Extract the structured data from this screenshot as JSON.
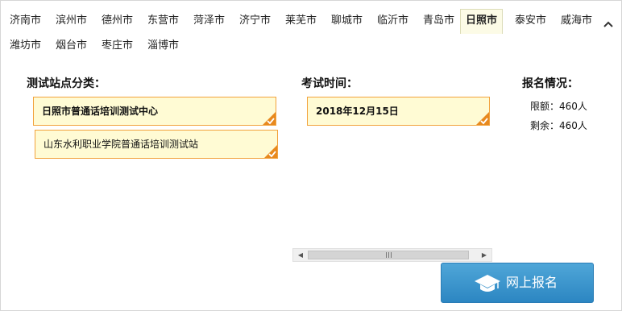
{
  "cities": [
    "济南市",
    "滨州市",
    "德州市",
    "东营市",
    "菏泽市",
    "济宁市",
    "莱芜市",
    "聊城市",
    "临沂市",
    "青岛市",
    "日照市",
    "泰安市",
    "威海市",
    "潍坊市",
    "烟台市",
    "枣庄市",
    "淄博市"
  ],
  "active_city": "日照市",
  "collapse_icon": "chevron-up-icon",
  "station": {
    "heading": "测试站点分类：",
    "options": [
      "日照市普通话培训测试中心",
      "山东水利职业学院普通话培训测试站"
    ]
  },
  "time": {
    "heading": "考试时间：",
    "options": [
      "2018年12月15日"
    ]
  },
  "status": {
    "heading": "报名情况：",
    "quota": "限额：460人",
    "remaining": "剩余：460人"
  },
  "register_button": "网上报名",
  "colors": {
    "option_bg": "#fffbd4",
    "option_border": "#f2a23c",
    "check_tick": "#e8891e",
    "button_blue": "#3a94cc",
    "active_tab_bg": "#fcfbe6"
  }
}
